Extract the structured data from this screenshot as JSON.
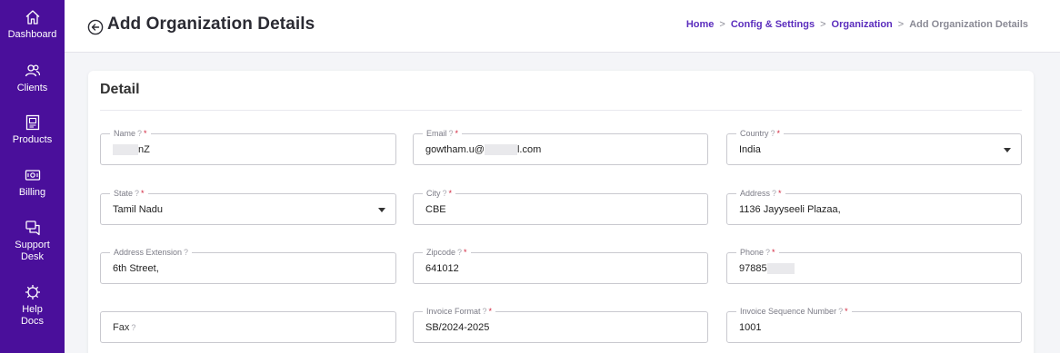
{
  "sidebar": {
    "items": [
      {
        "label": "Dashboard",
        "icon": "home-icon"
      },
      {
        "label": "Clients",
        "icon": "users-icon"
      },
      {
        "label": "Products",
        "icon": "products-icon"
      },
      {
        "label": "Billing",
        "icon": "billing-icon"
      },
      {
        "label": "Support Desk",
        "icon": "support-desk-icon"
      },
      {
        "label": "Help Docs",
        "icon": "help-docs-icon"
      }
    ],
    "colors": {
      "background": "#4a0f9b",
      "text": "#ffffff"
    }
  },
  "header": {
    "title": "Add Organization Details",
    "breadcrumb": {
      "home": "Home",
      "config": "Config & Settings",
      "organization": "Organization",
      "current": "Add Organization Details",
      "separator": ">"
    }
  },
  "card": {
    "title": "Detail"
  },
  "form": {
    "name": {
      "label": "Name",
      "value": "nZ",
      "required": "*",
      "help": "?"
    },
    "email": {
      "label": "Email",
      "value_prefix": "gowtham.u@",
      "value_suffix": "l.com",
      "required": "*",
      "help": "?"
    },
    "country": {
      "label": "Country",
      "value": "India",
      "required": "*",
      "help": "?"
    },
    "state": {
      "label": "State",
      "value": "Tamil Nadu",
      "required": "*",
      "help": "?"
    },
    "city": {
      "label": "City",
      "value": "CBE",
      "required": "*",
      "help": "?"
    },
    "address": {
      "label": "Address",
      "value": "1136 Jayyseeli Plazaa,",
      "required": "*",
      "help": "?"
    },
    "address_extension": {
      "label": "Address Extension",
      "value": "6th Street,",
      "help": "?"
    },
    "zipcode": {
      "label": "Zipcode",
      "value": "641012",
      "required": "*",
      "help": "?"
    },
    "phone": {
      "label": "Phone",
      "value": "97885",
      "required": "*",
      "help": "?"
    },
    "fax": {
      "placeholder": "Fax",
      "help": "?"
    },
    "invoice_format": {
      "label": "Invoice Format",
      "value": "SB/2024-2025",
      "required": "*",
      "help": "?"
    },
    "invoice_sequence": {
      "label": "Invoice Sequence Number",
      "value": "1001",
      "required": "*",
      "help": "?"
    }
  },
  "colors": {
    "accent": "#5b2dbd",
    "required": "#d1233c",
    "border": "#c9c9cf"
  }
}
